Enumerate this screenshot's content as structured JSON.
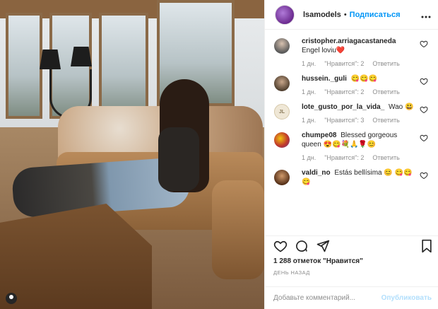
{
  "post": {
    "photo_alt": "photo",
    "author": {
      "username": "lsamodels",
      "separator": "•",
      "follow_label": "Подписаться",
      "more_label": "•••"
    }
  },
  "comments": [
    {
      "username": "cristopher.arriagacastaneda",
      "text": "Engel loviu❤️",
      "time": "1 дн.",
      "likes": "\"Нравится\": 2",
      "reply": "Ответить",
      "avatar_color": "#6e6e6e"
    },
    {
      "username": "hussein._guli",
      "text": "😋😋😋",
      "time": "1 дн.",
      "likes": "\"Нравится\": 2",
      "reply": "Ответить",
      "avatar_color": "#8a6b4f"
    },
    {
      "username": "lote_gusto_por_la_vida_",
      "text": "Wao 😃",
      "time": "1 дн.",
      "likes": "\"Нравится\": 3",
      "reply": "Ответить",
      "avatar_color": "#d9c9a7",
      "avatar_initials": "JL"
    },
    {
      "username": "chumpe08",
      "text": "Blessed gorgeous queen 😍😋💐🙏🌹😊",
      "time": "1 дн.",
      "likes": "\"Нравится\": 2",
      "reply": "Ответить",
      "avatar_color": "#c0392b"
    },
    {
      "username": "valdi_no",
      "text": "Estás bellísima 😊 😋😋😋",
      "time": "",
      "likes": "",
      "reply": "",
      "avatar_color": "#7a4a2a"
    }
  ],
  "stats": {
    "likes_text": "1 288 отметок \"Нравится\"",
    "date_text": "ДЕНЬ НАЗАД"
  },
  "add_comment": {
    "placeholder": "Добавьте комментарий...",
    "post_label": "Опубликовать"
  },
  "colors": {
    "accent": "#0095f6",
    "accent_disabled": "#b2dffc",
    "heart": "#e0245e"
  }
}
